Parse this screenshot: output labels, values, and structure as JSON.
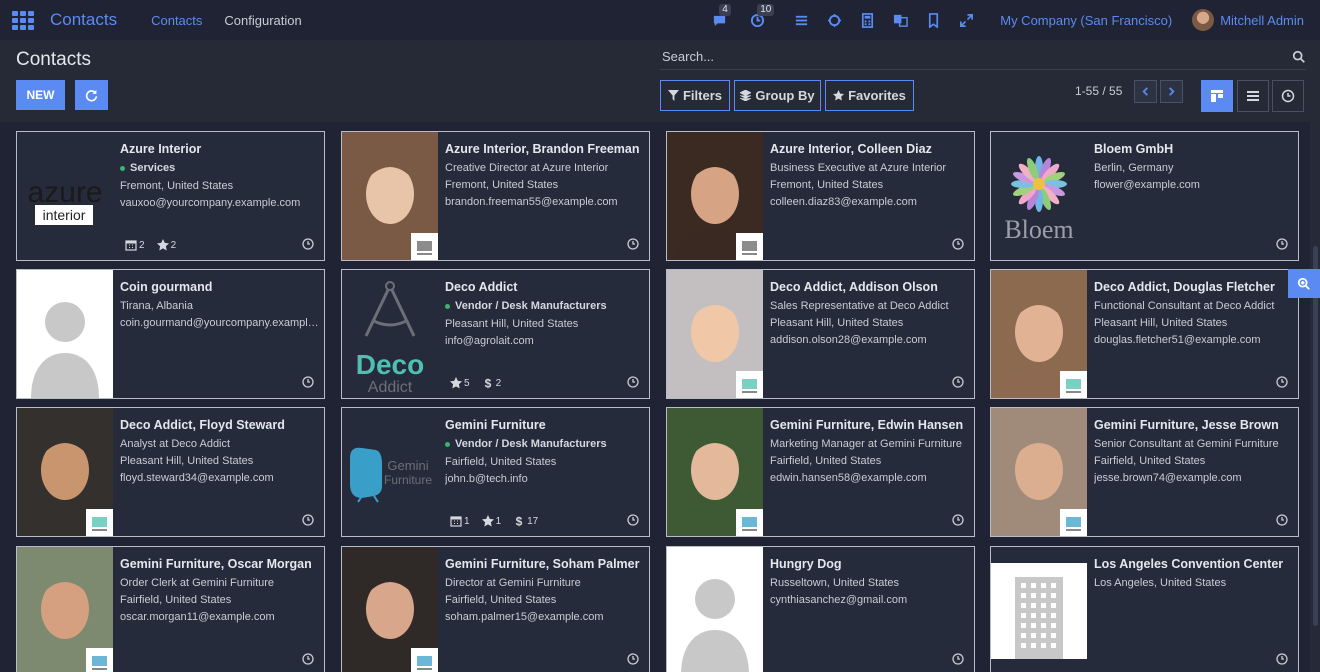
{
  "navbar": {
    "app_title": "Contacts",
    "menus": [
      "Contacts",
      "Configuration"
    ],
    "messages_count": "4",
    "activities_count": "10",
    "company": "My Company (San Francisco)",
    "user": "Mitchell Admin"
  },
  "control": {
    "title": "Contacts",
    "new_label": "NEW",
    "search_placeholder": "Search...",
    "filters_label": "Filters",
    "groupby_label": "Group By",
    "favorites_label": "Favorites",
    "pager": "1-55 / 55"
  },
  "cards": [
    {
      "name": "Azure Interior",
      "tag": "Services",
      "lines": [
        "Fremont, United States",
        "vauxoo@yourcompany.example.com"
      ],
      "stats": [
        {
          "icon": "calendar-icon",
          "value": "2"
        },
        {
          "icon": "star-icon",
          "value": "2"
        }
      ],
      "image": "azure-logo"
    },
    {
      "name": "Azure Interior, Brandon Freeman",
      "lines": [
        "Creative Director at Azure Interior",
        "Fremont, United States",
        "brandon.freeman55@example.com"
      ],
      "image": "photo",
      "logo": "azure"
    },
    {
      "name": "Azure Interior, Colleen Diaz",
      "lines": [
        "Business Executive at Azure Interior",
        "Fremont, United States",
        "colleen.diaz83@example.com"
      ],
      "image": "photo",
      "logo": "azure"
    },
    {
      "name": "Bloem GmbH",
      "lines": [
        "Berlin, Germany",
        "flower@example.com"
      ],
      "image": "bloem-logo"
    },
    {
      "name": "Coin gourmand",
      "lines": [
        "Tirana, Albania",
        "coin.gourmand@yourcompany.example.com"
      ],
      "image": "placeholder"
    },
    {
      "name": "Deco Addict",
      "tag": "Vendor / Desk Manufacturers",
      "lines": [
        "Pleasant Hill, United States",
        "info@agrolait.com"
      ],
      "stats": [
        {
          "icon": "star-icon",
          "value": "5"
        },
        {
          "icon": "dollar-icon",
          "value": "2"
        }
      ],
      "image": "deco-logo"
    },
    {
      "name": "Deco Addict, Addison Olson",
      "lines": [
        "Sales Representative at Deco Addict",
        "Pleasant Hill, United States",
        "addison.olson28@example.com"
      ],
      "image": "photo",
      "logo": "deco"
    },
    {
      "name": "Deco Addict, Douglas Fletcher",
      "lines": [
        "Functional Consultant at Deco Addict",
        "Pleasant Hill, United States",
        "douglas.fletcher51@example.com"
      ],
      "image": "photo",
      "logo": "deco"
    },
    {
      "name": "Deco Addict, Floyd Steward",
      "lines": [
        "Analyst at Deco Addict",
        "Pleasant Hill, United States",
        "floyd.steward34@example.com"
      ],
      "image": "photo",
      "logo": "deco"
    },
    {
      "name": "Gemini Furniture",
      "tag": "Vendor / Desk Manufacturers",
      "lines": [
        "Fairfield, United States",
        "john.b@tech.info"
      ],
      "stats": [
        {
          "icon": "calendar-icon",
          "value": "1"
        },
        {
          "icon": "star-icon",
          "value": "1"
        },
        {
          "icon": "dollar-icon",
          "value": "17"
        }
      ],
      "image": "gemini-logo"
    },
    {
      "name": "Gemini Furniture, Edwin Hansen",
      "lines": [
        "Marketing Manager at Gemini Furniture",
        "Fairfield, United States",
        "edwin.hansen58@example.com"
      ],
      "image": "photo",
      "logo": "gemini"
    },
    {
      "name": "Gemini Furniture, Jesse Brown",
      "lines": [
        "Senior Consultant at Gemini Furniture",
        "Fairfield, United States",
        "jesse.brown74@example.com"
      ],
      "image": "photo",
      "logo": "gemini"
    },
    {
      "name": "Gemini Furniture, Oscar Morgan",
      "lines": [
        "Order Clerk at Gemini Furniture",
        "Fairfield, United States",
        "oscar.morgan11@example.com"
      ],
      "image": "photo",
      "logo": "gemini"
    },
    {
      "name": "Gemini Furniture, Soham Palmer",
      "lines": [
        "Director at Gemini Furniture",
        "Fairfield, United States",
        "soham.palmer15@example.com"
      ],
      "image": "photo",
      "logo": "gemini"
    },
    {
      "name": "Hungry Dog",
      "lines": [
        "Russeltown, United States",
        "cynthiasanchez@gmail.com"
      ],
      "image": "placeholder"
    },
    {
      "name": "Los Angeles Convention Center",
      "lines": [
        "Los Angeles, United States"
      ],
      "image": "building"
    }
  ],
  "logos": {
    "azure_big": "azure",
    "azure_sub": "interior",
    "bloem": "Bloem",
    "deco_big": "Deco",
    "deco_sub": "Addict",
    "gemini_big": "Gemini",
    "gemini_sub": "Furniture"
  },
  "colors": {
    "accent": "#5b8bf2",
    "navbar_bg": "#1f2333",
    "card_bg": "#262b3c",
    "tag_dot": "#3cb371"
  }
}
